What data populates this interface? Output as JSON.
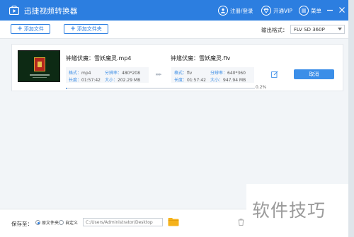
{
  "app": {
    "title": "迅捷视频转换器",
    "user_label": "注册/登录",
    "vip_label": "开通VIP",
    "menu_label": "菜单"
  },
  "toolbar": {
    "add_file_label": "添加文件",
    "add_folder_label": "添加文件夹",
    "format_label": "输出格式：",
    "format_value": "FLV  SD 360P"
  },
  "task": {
    "source": {
      "filename": "钟馗伏魔：雪妖魔灵.mp4",
      "format_key": "格式：",
      "format_val": "mp4",
      "resolution_key": "分辨率：",
      "resolution_val": "480*208",
      "duration_key": "长度：",
      "duration_val": "01:57:42",
      "size_key": "大小：",
      "size_val": "202.29 MB"
    },
    "target": {
      "filename": "钟馗伏魔：雪妖魔灵.flv",
      "format_key": "格式：",
      "format_val": "flv",
      "resolution_key": "分辨率：",
      "resolution_val": "640*360",
      "duration_key": "长度：",
      "duration_val": "01:57:42",
      "size_key": "大小：",
      "size_val": "947.94 MB"
    },
    "cancel_label": "取消",
    "progress_text": "0.2%",
    "progress_fraction": 0.002
  },
  "footer": {
    "save_label": "保存至：",
    "radio_original": "原文件夹",
    "radio_custom": "自定义",
    "path_placeholder": "C:/Users/Administrator/Desktop"
  },
  "watermark": {
    "text": "软件技巧"
  },
  "colors": {
    "brand": "#2c7ee0",
    "button": "#3b8ee8",
    "folder": "#f5b21b"
  }
}
